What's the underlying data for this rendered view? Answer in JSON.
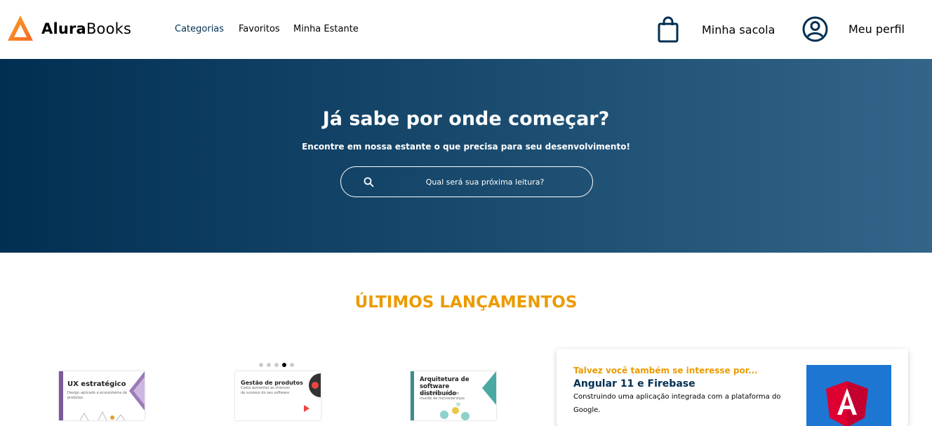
{
  "brand": {
    "name_bold": "Alura",
    "name_rest": "Books"
  },
  "nav": [
    {
      "label": "Categorias",
      "active": true
    },
    {
      "label": "Favoritos"
    },
    {
      "label": "Minha Estante"
    }
  ],
  "actions": {
    "bag_label": "Minha sacola",
    "profile_label": "Meu perfil"
  },
  "hero": {
    "title": "Já sabe por onde começar?",
    "subtitle": "Encontre em nossa estante o que precisa para seu desenvolvimento!",
    "search_placeholder": "Qual será sua próxima leitura?"
  },
  "releases": {
    "title": "ÚLTIMOS LANÇAMENTOS",
    "books": [
      {
        "title": "UX estratégico",
        "subtitle": "Design aplicado a ecossistema de produtos"
      },
      {
        "title": "Gestão de produtos",
        "subtitle": "Como aumentar as chances de sucesso do seu software"
      },
      {
        "title": "Arquitetura de software distribuído",
        "subtitle": "Boas práticas para um mundo de microsserviços"
      }
    ],
    "carousel_active_index": 3
  },
  "suggestion": {
    "kicker": "Talvez você também se interesse por...",
    "title": "Angular 11 e Firebase",
    "description": "Construindo uma aplicação integrada com a plataforma do Google."
  },
  "colors": {
    "primary": "#002f52",
    "accent": "#eb9b00",
    "logo_orange": "#f56b2a",
    "angular": "#dd0031"
  }
}
